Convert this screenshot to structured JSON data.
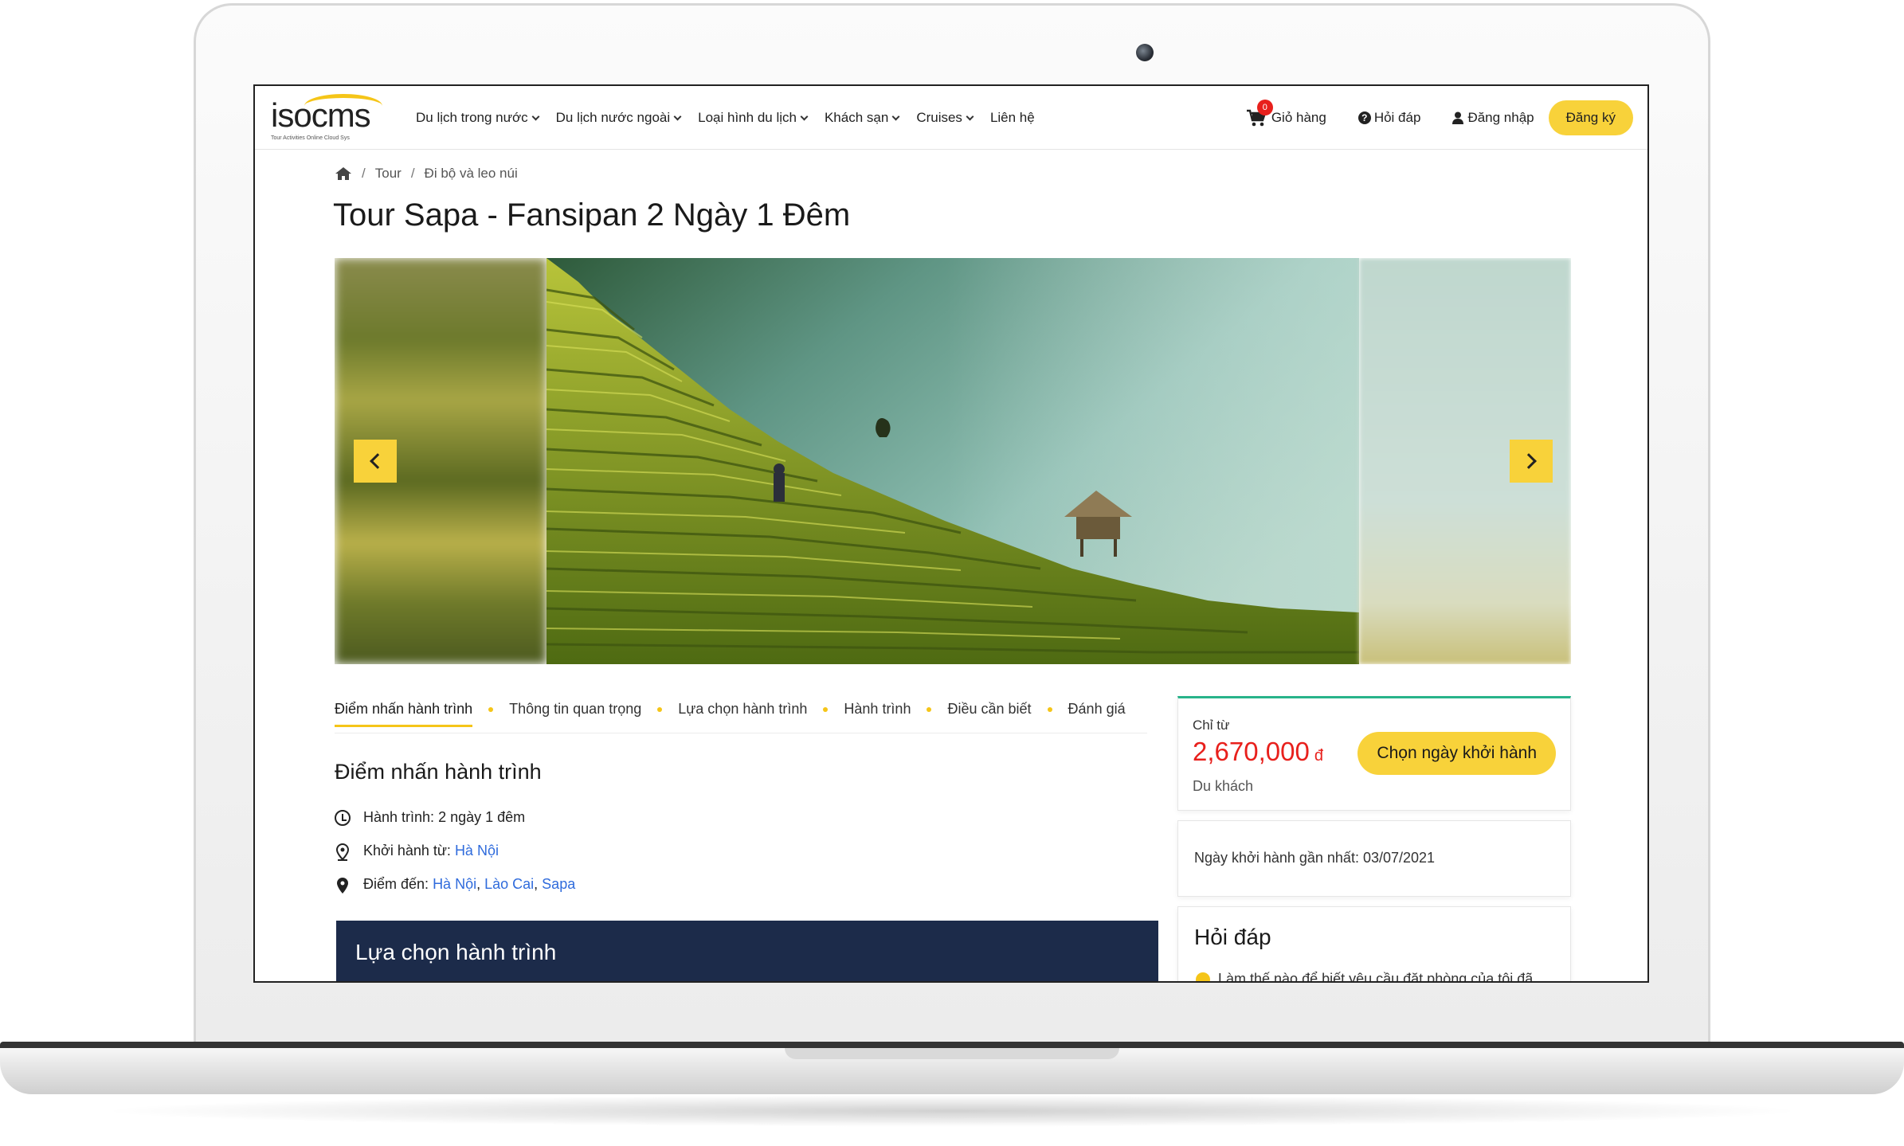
{
  "brand": {
    "logo_text": "isocms",
    "tagline": "Tour Activities Online Cloud Sys"
  },
  "nav": {
    "items": [
      {
        "label": "Du lịch trong nước",
        "dropdown": true
      },
      {
        "label": "Du lịch nước ngoài",
        "dropdown": true
      },
      {
        "label": "Loại hình du lịch",
        "dropdown": true
      },
      {
        "label": "Khách sạn",
        "dropdown": true
      },
      {
        "label": "Cruises",
        "dropdown": true
      },
      {
        "label": "Liên hệ",
        "dropdown": false
      }
    ],
    "cart_label": "Giỏ hàng",
    "cart_count": "0",
    "faq_label": "Hỏi đáp",
    "login_label": "Đăng nhập",
    "register_label": "Đăng ký"
  },
  "breadcrumb": {
    "items": [
      "Tour",
      "Đi bộ và leo núi"
    ],
    "separator": "/"
  },
  "page_title": "Tour Sapa - Fansipan 2 Ngày 1 Đêm",
  "tabs": [
    {
      "label": "Điểm nhấn hành trình",
      "active": true
    },
    {
      "label": "Thông tin quan trọng",
      "active": false
    },
    {
      "label": "Lựa chọn hành trình",
      "active": false
    },
    {
      "label": "Hành trình",
      "active": false
    },
    {
      "label": "Điều cần biết",
      "active": false
    },
    {
      "label": "Đánh giá",
      "active": false
    }
  ],
  "highlights": {
    "title": "Điểm nhấn hành trình",
    "duration_label": "Hành trình:",
    "duration_value": "2 ngày 1 đêm",
    "departure_label": "Khởi hành từ:",
    "departure_value": "Hà Nội",
    "destination_label": "Điểm đến:",
    "destinations": [
      "Hà Nội",
      "Lào Cai",
      "Sapa"
    ]
  },
  "itinerary_choice_title": "Lựa chọn hành trình",
  "price_card": {
    "from_label": "Chỉ từ",
    "price": "2,670,000",
    "currency": "đ",
    "unit": "Du khách",
    "cta": "Chọn ngày khởi hành"
  },
  "nearest_departure": "Ngày khởi hành gần nhất: 03/07/2021",
  "faq": {
    "title": "Hỏi đáp",
    "first_question": "Làm thế nào để biết yêu cầu đặt phòng của tôi đã"
  },
  "colors": {
    "accent_yellow": "#f8d23a",
    "price_red": "#e8201c",
    "link_blue": "#2f6bdc",
    "dark_navy": "#1c2b4a",
    "card_top_green": "#27b38a"
  }
}
